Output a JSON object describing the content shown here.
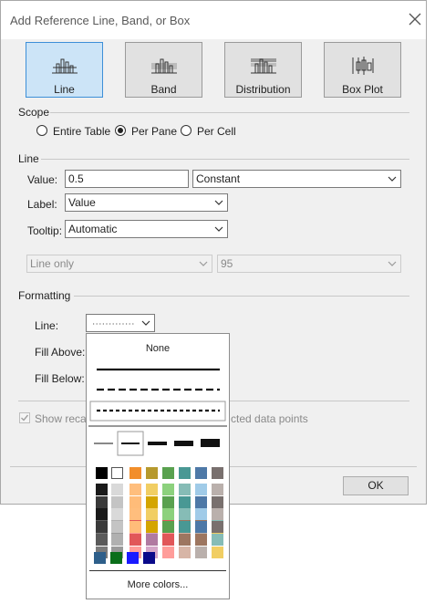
{
  "dialog": {
    "title": "Add Reference Line, Band, or Box",
    "types": [
      {
        "label": "Line",
        "icon": "reference-line-icon",
        "active": true
      },
      {
        "label": "Band",
        "icon": "reference-band-icon",
        "active": false
      },
      {
        "label": "Distribution",
        "icon": "distribution-icon",
        "active": false
      },
      {
        "label": "Box Plot",
        "icon": "box-plot-icon",
        "active": false
      }
    ],
    "scope": {
      "heading": "Scope",
      "options": [
        "Entire Table",
        "Per Pane",
        "Per Cell"
      ],
      "selected": "Per Pane"
    },
    "line_section": {
      "heading": "Line",
      "value_label": "Value:",
      "value": "0.5",
      "value_type": "Constant",
      "label_label": "Label:",
      "label_value": "Value",
      "tooltip_label": "Tooltip:",
      "tooltip_value": "Automatic",
      "line_only": "Line only",
      "confidence": "95"
    },
    "formatting": {
      "heading": "Formatting",
      "line_label": "Line:",
      "fill_above_label": "Fill Above:",
      "fill_below_label": "Fill Below:"
    },
    "recalc": {
      "text_left": "Show recalc",
      "text_right": "cted data points",
      "checked": true
    },
    "ok_label": "OK"
  },
  "popup": {
    "none_label": "None",
    "more_colors": "More colors...",
    "colors": {
      "top_row": [
        "#000000",
        "#ffffff",
        "#f28e2b",
        "#b6992d",
        "#59a14f",
        "#499894",
        "#4e79a7",
        "#79706e"
      ],
      "columns": [
        [
          "#1a1a1a",
          "#3a3a3a",
          "#5a5a5a",
          "#7a7a7a"
        ],
        [
          "#d9d9d9",
          "#c4c4c4",
          "#b0b0b0",
          "#9a9a9a"
        ],
        [
          "#ffbe7d",
          "#ffbc79",
          "#e15759",
          "#ff9d9a"
        ],
        [
          "#f1ce63",
          "#d4a500",
          "#b07aa1",
          "#d4a6c8"
        ],
        [
          "#8cd17d",
          "#59a14f",
          "#e15759",
          "#ff9d9a"
        ],
        [
          "#86bcb6",
          "#499894",
          "#9d7660",
          "#d7b5a6"
        ],
        [
          "#a0cbe8",
          "#4e79a7",
          "#9d7660",
          "#bab0ac"
        ],
        [
          "#bab0ac",
          "#79706e",
          "#86bcb6",
          "#f1ce63"
        ]
      ],
      "bottom_row": [
        "#2e5f8a",
        "#0a6e1a",
        "#1a1aff",
        "#0a0a8a"
      ]
    }
  }
}
